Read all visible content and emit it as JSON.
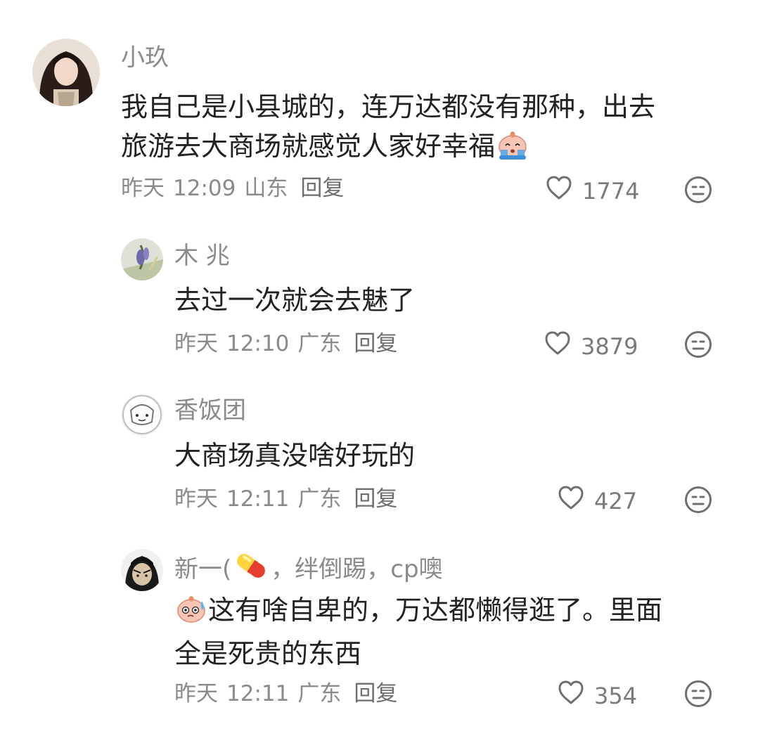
{
  "comments": [
    {
      "username": "小玖",
      "text_lines": [
        "我自己是小县城的，连万达都没有那种，出去",
        "旅游去大商场就感觉人家好幸福"
      ],
      "date": "昨天",
      "time": "12:09",
      "location": "山东",
      "reply_label": "回复",
      "likes": "1774"
    },
    {
      "username": "木 兆",
      "text_lines": [
        "去过一次就会去魅了"
      ],
      "date": "昨天",
      "time": "12:10",
      "location": "广东",
      "reply_label": "回复",
      "likes": "3879"
    },
    {
      "username": "香饭团",
      "text_lines": [
        "大商场真没啥好玩的"
      ],
      "date": "昨天",
      "time": "12:11",
      "location": "广东",
      "reply_label": "回复",
      "likes": "427"
    },
    {
      "username_prefix": "新一(",
      "username_suffix": "，绊倒踢，cp噢",
      "text_lines": [
        "这有啥自卑的，万达都懒得逛了。里面",
        "全是死贵的东西"
      ],
      "date": "昨天",
      "time": "12:11",
      "location": "广东",
      "reply_label": "回复",
      "likes": "354"
    }
  ],
  "icons": {
    "like": "heart-outline-icon",
    "dislike": "unamused-face-icon",
    "pill": "pill-emoji",
    "crying": "crying-face-emoji",
    "sweat": "sweat-face-emoji"
  },
  "colors": {
    "text": "#222222",
    "secondary": "#8a8a8a",
    "icon": "#7a7a7a"
  }
}
